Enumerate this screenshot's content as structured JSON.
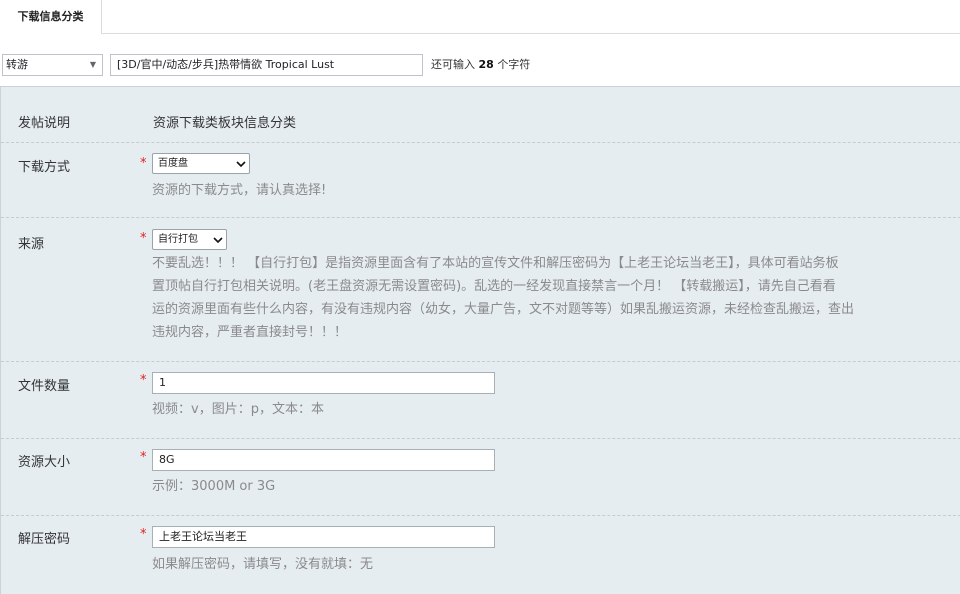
{
  "tabs": [
    {
      "label": "下载信息分类"
    }
  ],
  "topbar": {
    "type_select": {
      "value": "转游"
    },
    "title_input": {
      "value": "[3D/官中/动态/步兵]热带情欲 Tropical Lust"
    },
    "remaining": {
      "prefix": "还可输入",
      "count": "28",
      "suffix": "个字符"
    }
  },
  "form": {
    "intro": {
      "label": "发帖说明",
      "value": "资源下载类板块信息分类"
    },
    "download_method": {
      "label": "下载方式",
      "required": "*",
      "value": "百度盘",
      "hint": "资源的下载方式，请认真选择!"
    },
    "source": {
      "label": "来源",
      "required": "*",
      "value": "自行打包",
      "hint_lines": [
        "不要乱选！！！ 【自行打包】是指资源里面含有了本站的宣传文件和解压密码为【上老王论坛当老王】，具体可看站务板",
        "置顶帖自行打包相关说明。(老王盘资源无需设置密码)。乱选的一经发现直接禁言一个月！ 【转载搬运】，请先自己看看",
        "运的资源里面有些什么内容，有没有违规内容（幼女，大量广告，文不对题等等）如果乱搬运资源，未经检查乱搬运，查出",
        "违规内容，严重者直接封号！！！"
      ]
    },
    "file_count": {
      "label": "文件数量",
      "required": "*",
      "value": "1",
      "hint": "视频：v，图片：p，文本：本"
    },
    "size": {
      "label": "资源大小",
      "required": "*",
      "value": "8G",
      "hint": "示例：3000M or 3G"
    },
    "password": {
      "label": "解压密码",
      "required": "*",
      "value": "上老王论坛当老王",
      "hint": "如果解压密码，请填写，没有就填：无"
    }
  },
  "colors": {
    "panel_bg": "#e6edf1",
    "required": "#e02020",
    "hint": "#8a8a8a"
  }
}
